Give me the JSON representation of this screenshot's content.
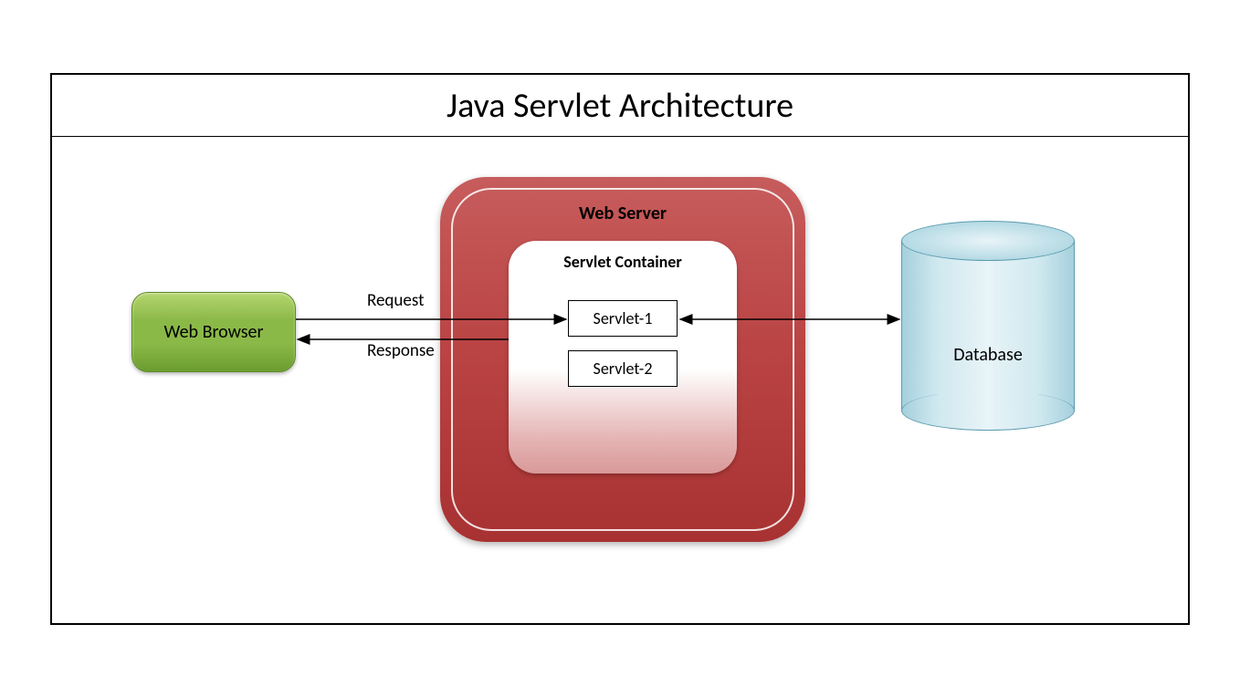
{
  "title": "Java Servlet Architecture",
  "components": {
    "browser": "Web Browser",
    "webServer": "Web Server",
    "servletContainer": "Servlet Container",
    "servlet1": "Servlet-1",
    "servlet2": "Servlet-2",
    "database": "Database"
  },
  "flows": {
    "request": "Request",
    "response": "Response"
  },
  "colors": {
    "browserFill": "#8bb948",
    "webServerFill": "#b94242",
    "databaseFill": "#cfe8ef"
  }
}
